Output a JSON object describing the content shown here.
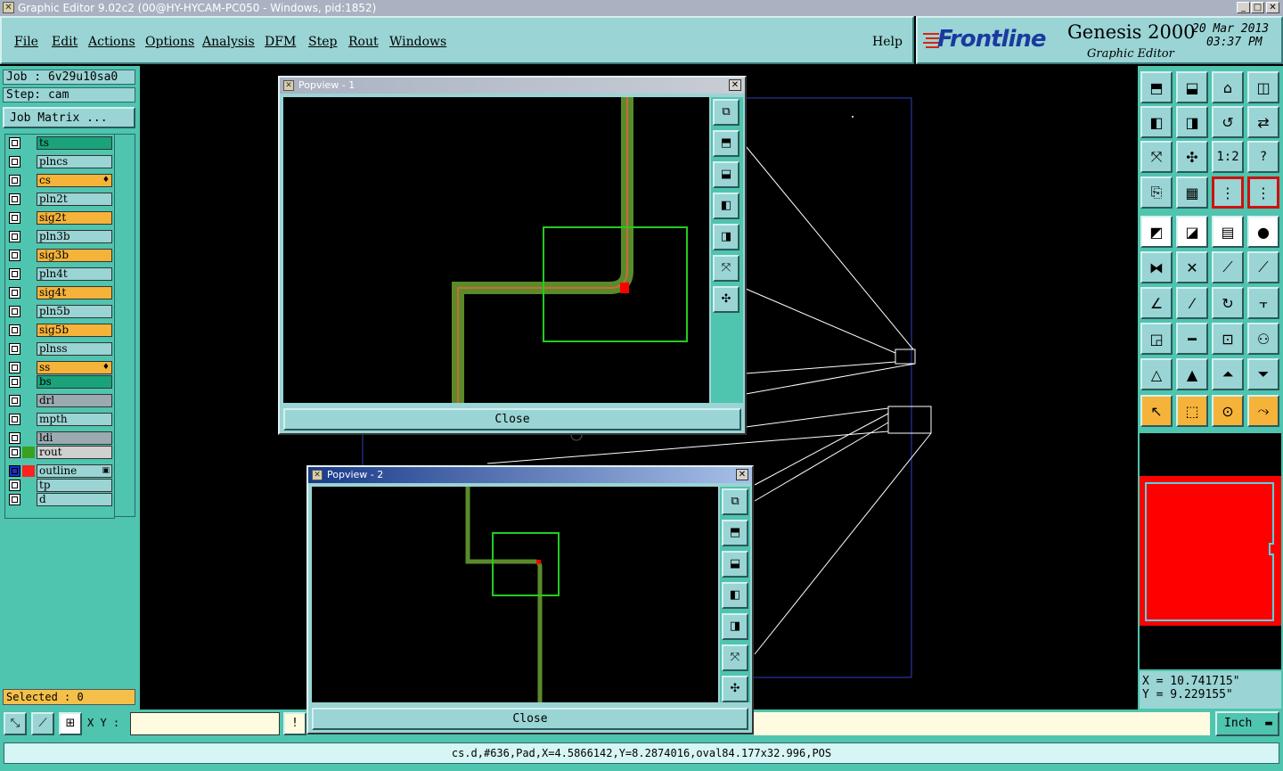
{
  "window": {
    "title": "Graphic Editor 9.02c2 (00@HY-HYCAM-PC050 - Windows, pid:1852)",
    "min_glyph": "_",
    "max_glyph": "□",
    "close_glyph": "✕"
  },
  "menu": {
    "items": [
      "File",
      "Edit",
      "Actions",
      "Options",
      "Analysis",
      "DFM",
      "Step",
      "Rout",
      "Windows"
    ],
    "help": "Help"
  },
  "brand": {
    "logo": "Frontline",
    "product": "Genesis 2000",
    "subtitle": "Graphic Editor",
    "date": "20 Mar 2013",
    "time": "03:37 PM"
  },
  "job": {
    "job_label": "Job  : 6v29u10sa0",
    "step_label": "Step: cam",
    "matrix_button": "Job Matrix ..."
  },
  "layers": [
    {
      "name": "ts",
      "color": "#1aa37a",
      "marker": ""
    },
    {
      "name": "plncs",
      "color": "#9ad4d4",
      "marker": ""
    },
    {
      "name": "cs",
      "color": "#f5b33a",
      "marker": "♦"
    },
    {
      "name": "pln2t",
      "color": "#9ad4d4",
      "marker": ""
    },
    {
      "name": "sig2t",
      "color": "#f5b33a",
      "marker": ""
    },
    {
      "name": "pln3b",
      "color": "#9ad4d4",
      "marker": ""
    },
    {
      "name": "sig3b",
      "color": "#f5b33a",
      "marker": ""
    },
    {
      "name": "pln4t",
      "color": "#9ad4d4",
      "marker": ""
    },
    {
      "name": "sig4t",
      "color": "#f5b33a",
      "marker": ""
    },
    {
      "name": "pln5b",
      "color": "#9ad4d4",
      "marker": ""
    },
    {
      "name": "sig5b",
      "color": "#f5b33a",
      "marker": ""
    },
    {
      "name": "plnss",
      "color": "#9ad4d4",
      "marker": ""
    },
    {
      "name": "ss",
      "color": "#f5b33a",
      "marker": "♦"
    },
    {
      "name": "bs",
      "color": "#1aa37a",
      "marker": ""
    },
    {
      "name": "drl",
      "color": "#9aaab0",
      "marker": ""
    },
    {
      "name": "mpth",
      "color": "#9ad4d4",
      "marker": ""
    },
    {
      "name": "ldi",
      "color": "#9aaab0",
      "marker": ""
    },
    {
      "name": "rout",
      "color": "#d0d0d0",
      "marker": ""
    },
    {
      "name": "outline",
      "color": "#9ad4d4",
      "marker": "▣"
    },
    {
      "name": "tp",
      "color": "#9ad4d4",
      "marker": ""
    },
    {
      "name": "d",
      "color": "#9ad4d4",
      "marker": ""
    }
  ],
  "selected": "Selected : 0",
  "toolbar": {
    "zoom_one_to_two": "1:2",
    "help_q": "?"
  },
  "coords": {
    "x": "X  = 10.741715\"",
    "y": "Y  = 9.229155\""
  },
  "bottom": {
    "xy_label": "X Y :",
    "xy_value": "",
    "warn": "!",
    "units": "Inch"
  },
  "status": "cs.d,#636,Pad,X=4.5866142,Y=8.2874016,oval84.177x32.996,POS",
  "popview1": {
    "title": "Popview - 1",
    "close": "Close"
  },
  "popview2": {
    "title": "Popview - 2",
    "close": "Close"
  },
  "colors": {
    "teal": "#4fc4ae",
    "light_teal": "#9ad4d4",
    "orange": "#f5b33a",
    "red": "#ff0000",
    "green": "#22cc22"
  }
}
